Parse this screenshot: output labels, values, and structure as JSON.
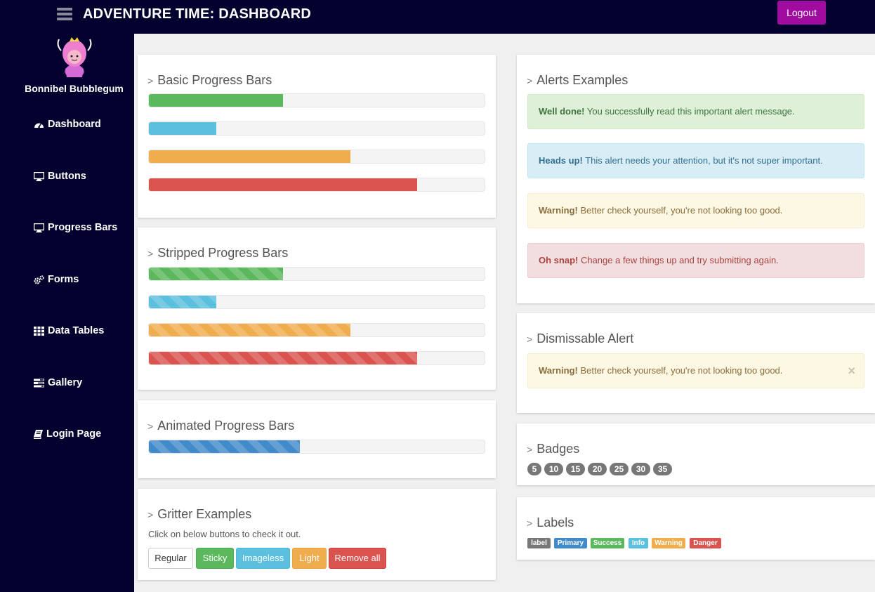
{
  "header": {
    "title": "ADVENTURE TIME: DASHBOARD",
    "logout_label": "Logout"
  },
  "sidebar": {
    "user_name": "Bonnibel Bubblegum",
    "items": [
      {
        "label": "Dashboard",
        "icon": "dashboard-icon"
      },
      {
        "label": "Buttons",
        "icon": "desktop-icon"
      },
      {
        "label": "Progress Bars",
        "icon": "desktop-icon"
      },
      {
        "label": "Forms",
        "icon": "cogs-icon"
      },
      {
        "label": "Data Tables",
        "icon": "th-icon"
      },
      {
        "label": "Gallery",
        "icon": "tasks-icon"
      },
      {
        "label": "Login Page",
        "icon": "book-icon"
      }
    ]
  },
  "basic_progress": {
    "title": "Basic Progress Bars",
    "bars": [
      {
        "percent": 40,
        "color": "#5cb85c"
      },
      {
        "percent": 20,
        "color": "#5bc0de"
      },
      {
        "percent": 60,
        "color": "#f0ad4e"
      },
      {
        "percent": 80,
        "color": "#d9534f"
      }
    ]
  },
  "striped_progress": {
    "title": "Stripped Progress Bars",
    "bars": [
      {
        "percent": 40,
        "color": "#5cb85c"
      },
      {
        "percent": 20,
        "color": "#5bc0de"
      },
      {
        "percent": 60,
        "color": "#f0ad4e"
      },
      {
        "percent": 80,
        "color": "#d9534f"
      }
    ]
  },
  "animated_progress": {
    "title": "Animated Progress Bars",
    "bars": [
      {
        "percent": 45,
        "color": "#428bca"
      }
    ]
  },
  "gritter": {
    "title": "Gritter Examples",
    "description": "Click on below buttons to check it out.",
    "buttons": [
      "Regular",
      "Sticky",
      "Imageless",
      "Light",
      "Remove all"
    ]
  },
  "alerts": {
    "title": "Alerts Examples",
    "items": [
      {
        "strong": "Well done!",
        "text": " You successfully read this important alert message."
      },
      {
        "strong": "Heads up!",
        "text": " This alert needs your attention, but it's not super important."
      },
      {
        "strong": "Warning!",
        "text": " Better check yourself, you're not looking too good."
      },
      {
        "strong": "Oh snap!",
        "text": " Change a few things up and try submitting again."
      }
    ]
  },
  "dismissable": {
    "title": "Dismissable Alert",
    "strong": "Warning!",
    "text": " Better check yourself, you're not looking too good.",
    "close": "×"
  },
  "badges": {
    "title": "Badges",
    "items": [
      "5",
      "10",
      "15",
      "20",
      "25",
      "30",
      "35"
    ]
  },
  "labels": {
    "title": "Labels",
    "items": [
      "label",
      "Primary",
      "Success",
      "Info",
      "Warning",
      "Danger"
    ]
  }
}
